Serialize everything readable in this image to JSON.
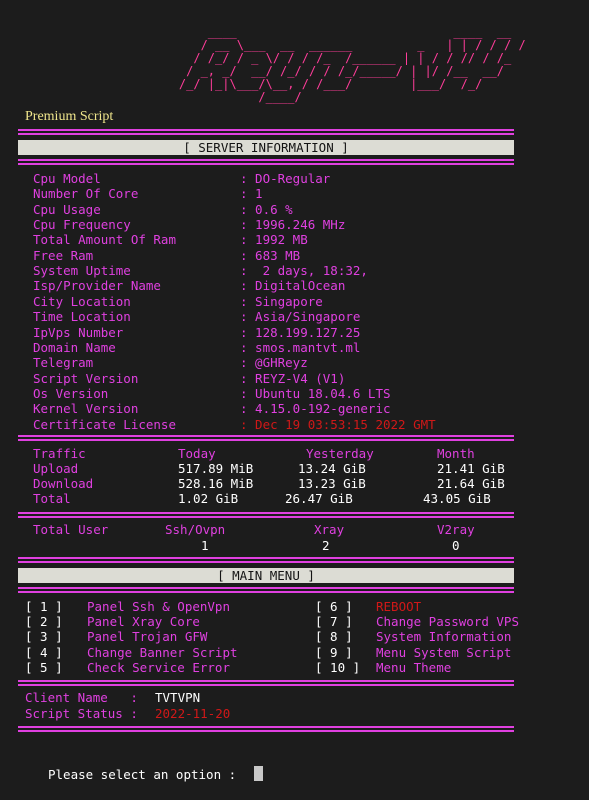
{
  "banner_art": "        ____                              ____  __\n       / __ \\___  __  ______         _   | | / / / /\n      / /_/ / _ \\/ / / /_  /______ | | / / // / /_\n     / _, _/  __/ /_/ / / /_/_____/ | |/ /__  __/\n    /_/ |_|\\___/\\__, / /___/        |___/  /_/\n               /____/",
  "premium_label": "Premium Script",
  "server_info": {
    "header": "[ SERVER INFORMATION ]",
    "rows": [
      {
        "key": "Cpu Model",
        "value": ": DO-Regular",
        "alert": false
      },
      {
        "key": "Number Of Core",
        "value": ": 1",
        "alert": false
      },
      {
        "key": "Cpu Usage",
        "value": ": 0.6 %",
        "alert": false
      },
      {
        "key": "Cpu Frequency",
        "value": ": 1996.246 MHz",
        "alert": false
      },
      {
        "key": "Total Amount Of Ram",
        "value": ": 1992 MB",
        "alert": false
      },
      {
        "key": "Free Ram",
        "value": ": 683 MB",
        "alert": false
      },
      {
        "key": "System Uptime",
        "value": ":  2 days, 18:32,",
        "alert": false
      },
      {
        "key": "Isp/Provider Name",
        "value": ": DigitalOcean",
        "alert": false
      },
      {
        "key": "City Location",
        "value": ": Singapore",
        "alert": false
      },
      {
        "key": "Time Location",
        "value": ": Asia/Singapore",
        "alert": false
      },
      {
        "key": "IpVps Number",
        "value": ": 128.199.127.25",
        "alert": false
      },
      {
        "key": "Domain Name",
        "value": ": smos.mantvt.ml",
        "alert": false
      },
      {
        "key": "Telegram",
        "value": ": @GHReyz",
        "alert": false
      },
      {
        "key": "Script Version",
        "value": ": REYZ-V4 (V1)",
        "alert": false
      },
      {
        "key": "Os Version",
        "value": ": Ubuntu 18.04.6 LTS",
        "alert": false
      },
      {
        "key": "Kernel Version",
        "value": ": 4.15.0-192-generic",
        "alert": false
      },
      {
        "key": "Certificate License",
        "value": ": Dec 19 03:53:15 2022 GMT",
        "alert": true
      }
    ]
  },
  "traffic": {
    "header_label": "Traffic",
    "columns": [
      "Today",
      "Yesterday",
      "Month"
    ],
    "rows": [
      {
        "label": "Upload",
        "today": "517.89 MiB",
        "yesterday": "13.24 GiB",
        "month": "21.41 GiB"
      },
      {
        "label": "Download",
        "today": "528.16 MiB",
        "yesterday": "13.23 GiB",
        "month": "21.64 GiB"
      },
      {
        "label": "Total",
        "today": "1.02 GiB",
        "yesterday": "26.47 GiB",
        "month": "43.05 GiB"
      }
    ]
  },
  "users": {
    "label": "Total User",
    "columns": [
      "Ssh/Ovpn",
      "Xray",
      "V2ray"
    ],
    "values": [
      "1",
      "2",
      "0"
    ]
  },
  "main_menu": {
    "header": "[ MAIN MENU ]",
    "left": [
      {
        "num": "[ 1 ]",
        "label": "Panel Ssh & OpenVpn",
        "alert": false
      },
      {
        "num": "[ 2 ]",
        "label": "Panel Xray Core",
        "alert": false
      },
      {
        "num": "[ 3 ]",
        "label": "Panel Trojan GFW",
        "alert": false
      },
      {
        "num": "[ 4 ]",
        "label": "Change Banner Script",
        "alert": false
      },
      {
        "num": "[ 5 ]",
        "label": "Check Service Error",
        "alert": false
      }
    ],
    "right": [
      {
        "num": "[ 6 ]",
        "label": "REBOOT",
        "alert": true
      },
      {
        "num": "[ 7 ]",
        "label": "Change Password VPS",
        "alert": false
      },
      {
        "num": "[ 8 ]",
        "label": "System Information",
        "alert": false
      },
      {
        "num": "[ 9 ]",
        "label": "Menu System Script",
        "alert": false
      },
      {
        "num": "[ 10 ]",
        "label": "Menu Theme",
        "alert": false
      }
    ]
  },
  "client": {
    "name_label": "Client Name   :",
    "name_value": "TVTVPN",
    "status_label": "Script Status :",
    "status_value": "2022-11-20"
  },
  "prompt": "Please select an option :",
  "colors": {
    "background": "#1c1c1c",
    "accent": "#e040e0",
    "alert": "#d01818",
    "banner": "#ff3d9a",
    "premium": "#f0e68c",
    "header_bar": "#dcdcd4"
  }
}
